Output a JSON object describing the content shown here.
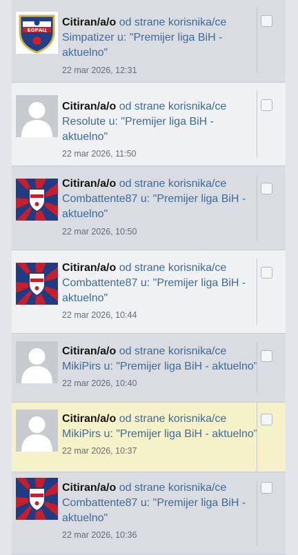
{
  "alerts": [
    {
      "username": "Simpatizer",
      "date": "22 mar 2026, 12:31",
      "avatar": "borac-crest",
      "variant": "odd"
    },
    {
      "username": "Resolute",
      "date": "22 mar 2026, 11:50",
      "avatar": "default",
      "variant": "even"
    },
    {
      "username": "Combattente87",
      "date": "22 mar 2026, 10:50",
      "avatar": "borac-flag",
      "variant": "odd"
    },
    {
      "username": "Combattente87",
      "date": "22 mar 2026, 10:44",
      "avatar": "borac-flag",
      "variant": "even"
    },
    {
      "username": "MikiPirs",
      "date": "22 mar 2026, 10:40",
      "avatar": "default",
      "variant": "odd"
    },
    {
      "username": "MikiPirs",
      "date": "22 mar 2026, 10:37",
      "avatar": "default",
      "variant": "hl"
    },
    {
      "username": "Combattente87",
      "date": "22 mar 2026, 10:36",
      "avatar": "borac-flag",
      "variant": "odd"
    }
  ],
  "labels": {
    "quoted": "Citiran/a/o",
    "by_user": "od strane korisnika/ce",
    "in_topic": "u:",
    "topic": "\"Premijer liga BiH - aktuelno\"",
    "crest_text": "БОРАЦ"
  },
  "colors": {
    "link": "#3e6a9a",
    "highlight": "#f5f2c9"
  }
}
